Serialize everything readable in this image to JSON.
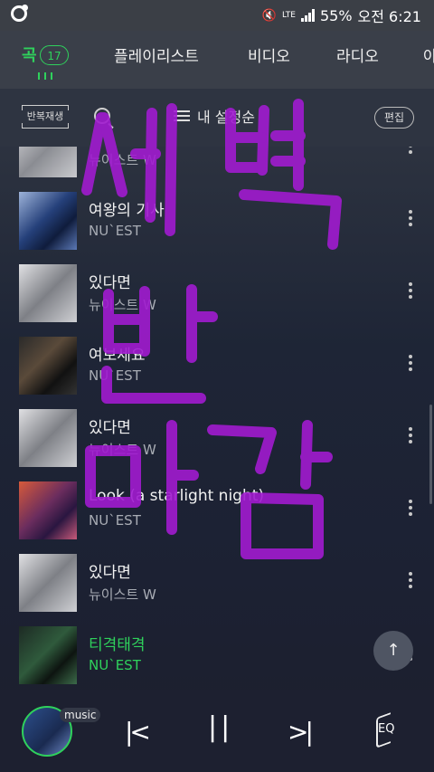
{
  "status": {
    "battery": "55%",
    "time": "오전 6:21",
    "network": "LTE"
  },
  "tabs": [
    {
      "label": "곡",
      "badge": "17",
      "active": true
    },
    {
      "label": "플레이리스트"
    },
    {
      "label": "비디오"
    },
    {
      "label": "라디오"
    },
    {
      "label": "아"
    }
  ],
  "toolbar": {
    "repeat": "반복재생",
    "settings": "내 설정순",
    "edit": "편집"
  },
  "songs": [
    {
      "title": "",
      "artist": "뉴이스트 W",
      "art": "gray"
    },
    {
      "title": "여왕의 기사",
      "artist": "NU`EST",
      "art": "blue"
    },
    {
      "title": "있다면",
      "artist": "뉴이스트 W",
      "art": "gray"
    },
    {
      "title": "여보세요",
      "artist": "NU`EST",
      "art": "dark"
    },
    {
      "title": "있다면",
      "artist": "뉴이스트 W",
      "art": "gray"
    },
    {
      "title": "Look (a starlight night)",
      "artist": "NU`EST",
      "art": "nuest"
    },
    {
      "title": "있다면",
      "artist": "뉴이스트 W",
      "art": "gray"
    },
    {
      "title": "티격태격",
      "artist": "NU`EST",
      "art": "green",
      "active": true
    }
  ],
  "player": {
    "label": "music"
  },
  "colors": {
    "accent": "#2fd15c",
    "doodle": "#a11bd0"
  },
  "doodle_text": "새벽 반 마감"
}
